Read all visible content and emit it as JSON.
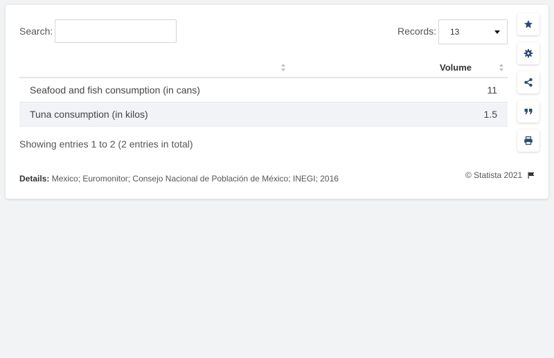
{
  "search": {
    "label": "Search:",
    "value": "",
    "placeholder": ""
  },
  "records": {
    "label": "Records:",
    "value": "13"
  },
  "table": {
    "columns": [
      "",
      "Volume"
    ],
    "rows": [
      {
        "name": "Seafood and fish consumption (in cans)",
        "value": "11"
      },
      {
        "name": "Tuna consumption (in kilos)",
        "value": "1.5"
      }
    ]
  },
  "entries_info": "Showing entries 1 to 2 (2 entries in total)",
  "details": {
    "label": "Details:",
    "text": "Mexico; Euromonitor; Consejo Nacional de Población de México; INEGI; 2016"
  },
  "copyright": "© Statista 2021",
  "sidebar": {
    "icons": [
      "star-icon",
      "gear-icon",
      "share-icon",
      "quote-icon",
      "print-icon"
    ]
  },
  "colors": {
    "icon": "#2e4a77",
    "alt_row": "#f1f3f6"
  },
  "chart_data": {
    "type": "table",
    "columns": [
      "",
      "Volume"
    ],
    "rows": [
      [
        "Seafood and fish consumption (in cans)",
        11
      ],
      [
        "Tuna consumption (in kilos)",
        1.5
      ]
    ]
  }
}
